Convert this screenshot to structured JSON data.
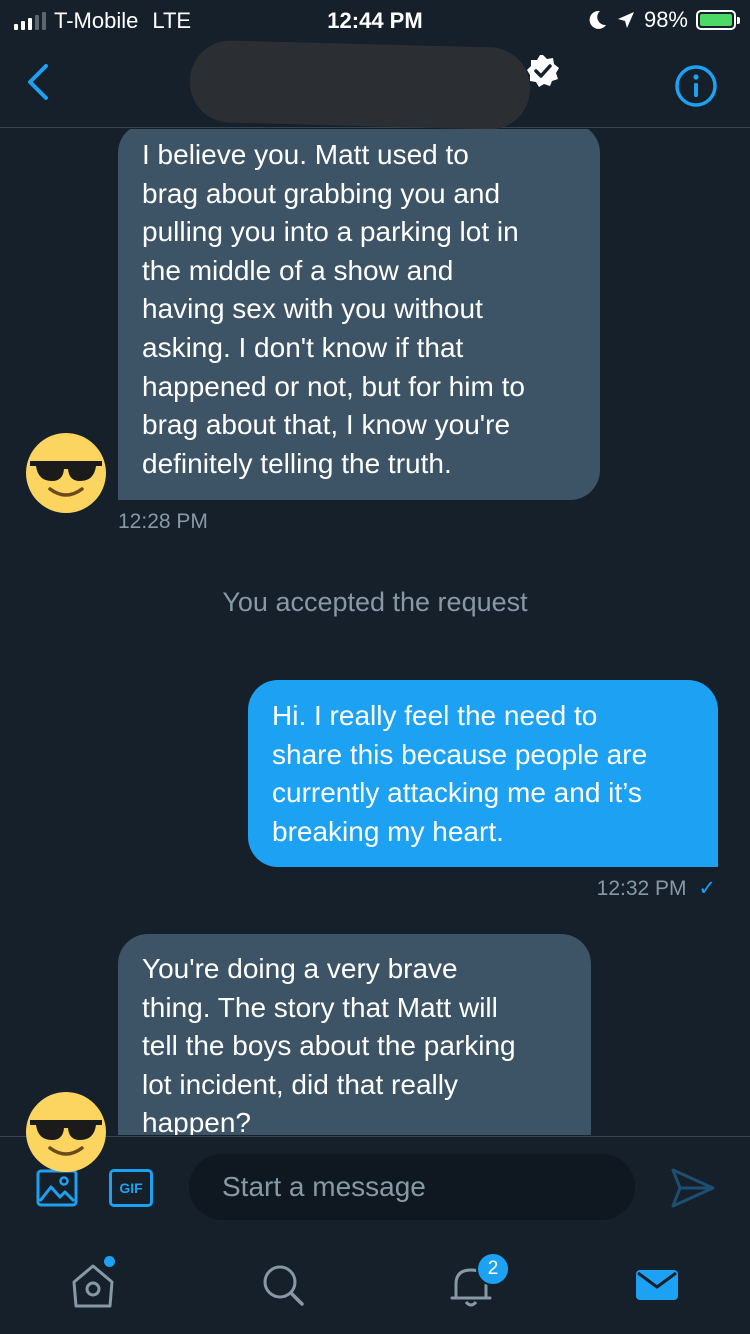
{
  "status_bar": {
    "carrier": "T-Mobile",
    "network": "LTE",
    "time": "12:44 PM",
    "battery": "98%"
  },
  "header": {
    "back_icon": "chevron-left-icon",
    "info_icon": "info-icon"
  },
  "messages": [
    {
      "direction": "received",
      "lines": [
        "I believe you. Matt used to",
        "brag about grabbing you and",
        "pulling you into a parking lot in",
        "the middle of a show and",
        "having sex with you without",
        "asking. I don't know if that",
        "happened or not, but for him to",
        "brag about that, I know you're",
        "definitely telling the truth."
      ],
      "time": "12:28 PM"
    },
    {
      "direction": "system",
      "text": "You accepted the request"
    },
    {
      "direction": "sent",
      "lines": [
        "Hi. I really feel the need to",
        "share this because people are",
        "currently attacking me and it’s",
        "breaking my heart."
      ],
      "time": "12:32 PM",
      "read_mark": "✓"
    },
    {
      "direction": "received",
      "lines": [
        "You're doing a very brave",
        "thing. The story that Matt will",
        "tell the boys about the parking",
        "lot incident, did that really",
        "happen?"
      ]
    }
  ],
  "composer": {
    "placeholder": "Start a message",
    "gif_label": "GIF"
  },
  "tab_bar": {
    "notification_count": "2"
  },
  "colors": {
    "background": "#15202b",
    "received_bubble": "#3d5466",
    "sent_bubble": "#1da1f2",
    "accent": "#1da1f2",
    "muted_text": "#8899a6"
  }
}
